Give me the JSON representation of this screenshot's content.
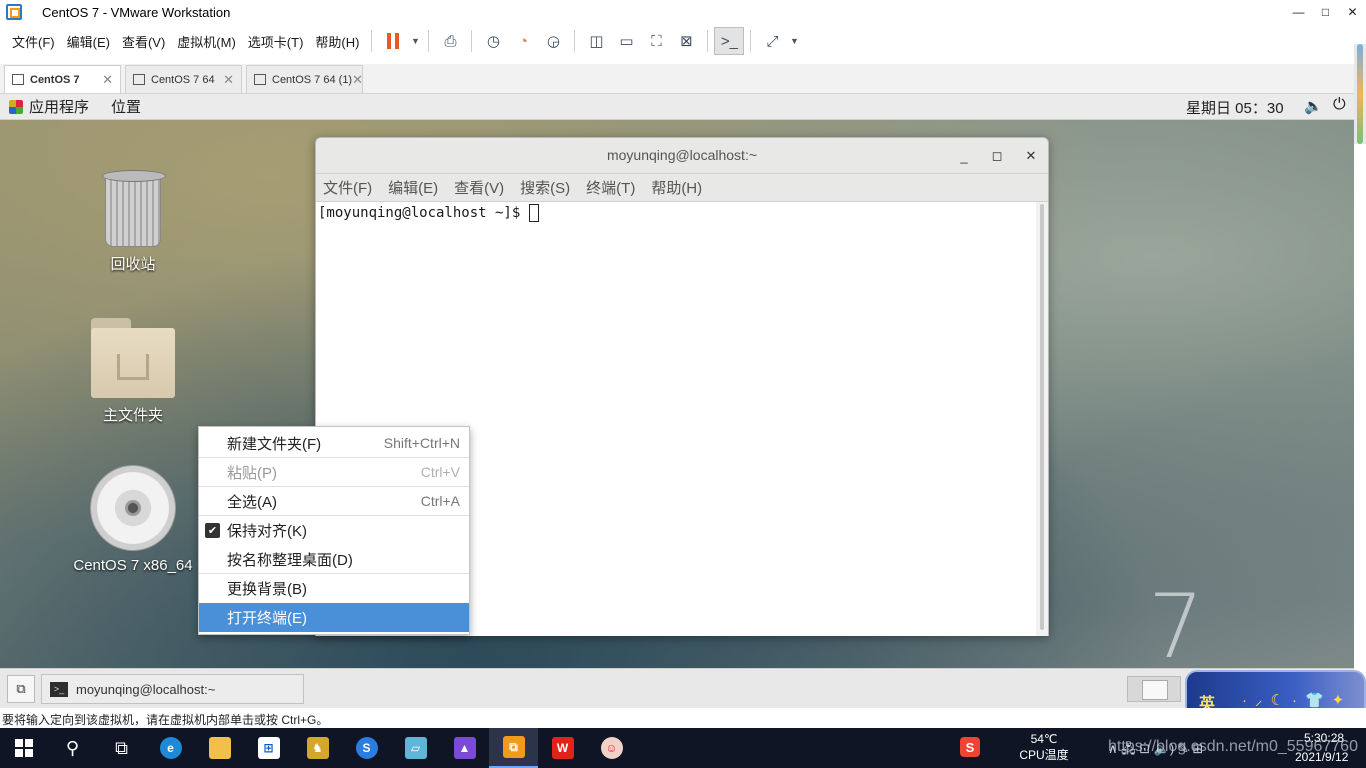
{
  "window": {
    "title": "CentOS 7  - VMware Workstation",
    "minimize": "—",
    "maximize": "□",
    "close": "✕"
  },
  "vm_menu": [
    "文件(F)",
    "编辑(E)",
    "查看(V)",
    "虚拟机(M)",
    "选项卡(T)",
    "帮助(H)"
  ],
  "toolbar_icons": [
    "pause-icon",
    "send-ctrl-alt-del-icon",
    "snapshot-icon",
    "revert-snapshot-icon",
    "snapshot-manager-icon",
    "library-icon",
    "console-view-icon",
    "fullscreen-icon",
    "unity-icon",
    "terminal-view-icon",
    "stretch-icon"
  ],
  "accent_colors": {
    "pause": "#ea5a1e",
    "selection": "#4a90d9",
    "taskbar": "#0f1524"
  },
  "vm_tabs": [
    {
      "label": "CentOS 7",
      "active": true
    },
    {
      "label": "CentOS 7 64",
      "active": false
    },
    {
      "label": "CentOS 7 64 (1)",
      "active": false
    }
  ],
  "gnome_top": {
    "applications": "应用程序",
    "places": "位置",
    "clock": "星期日 05：30"
  },
  "desktop_icons": {
    "trash": "回收站",
    "home": "主文件夹",
    "disc": "CentOS 7 x86_64"
  },
  "desktop_logo": "7",
  "terminal": {
    "title": "moyunqing@localhost:~",
    "menu": [
      "文件(F)",
      "编辑(E)",
      "查看(V)",
      "搜索(S)",
      "终端(T)",
      "帮助(H)"
    ],
    "prompt": "[moyunqing@localhost ~]$ "
  },
  "context_menu": [
    {
      "label": "新建文件夹(F)",
      "shortcut": "Shift+Ctrl+N",
      "disabled": false,
      "checked": false
    },
    {
      "label": "粘贴(P)",
      "shortcut": "Ctrl+V",
      "disabled": true,
      "checked": false
    },
    {
      "label": "全选(A)",
      "shortcut": "Ctrl+A",
      "disabled": false,
      "checked": false
    },
    {
      "label": "保持对齐(K)",
      "shortcut": "",
      "disabled": false,
      "checked": true
    },
    {
      "label": "按名称整理桌面(D)",
      "shortcut": "",
      "disabled": false,
      "checked": false
    },
    {
      "label": "更换背景(B)",
      "shortcut": "",
      "disabled": false,
      "checked": false
    },
    {
      "label": "打开终端(E)",
      "shortcut": "",
      "disabled": false,
      "checked": false,
      "selected": true
    }
  ],
  "gnome_bottom": {
    "task_terminal": "moyunqing@localhost:~"
  },
  "ime": {
    "lang": "英",
    "deco": "·⸝☾·👕✦"
  },
  "vm_status": "要将输入定向到该虚拟机，请在虚拟机内部单击或按 Ctrl+G。",
  "win_taskbar": {
    "cpu_temp": "54℃",
    "cpu_label": "CPU温度",
    "tray": "∧  🖧  ⊡  🔈)  ✎  ⊞",
    "time": "5:30:28",
    "date": "2021/9/12",
    "watermark": "https://blog.csdn.net/m0_55967760"
  }
}
